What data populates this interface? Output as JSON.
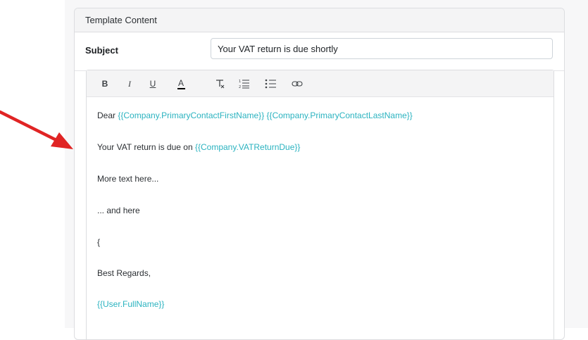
{
  "panel": {
    "title": "Template Content"
  },
  "subject": {
    "label": "Subject",
    "value": "Your VAT return is due shortly"
  },
  "toolbar": {
    "buttons": [
      {
        "name": "bold",
        "glyph": "B"
      },
      {
        "name": "italic",
        "glyph": "I"
      },
      {
        "name": "underline",
        "glyph": "U"
      },
      {
        "name": "font-color",
        "glyph": "A"
      }
    ]
  },
  "editor": {
    "greeting": "Dear ",
    "first_name_tag": "{{Company.PrimaryContactFirstName}}",
    "last_name_tag": "{{Company.PrimaryContactLastName}}",
    "vat_text": "Your VAT return is due on ",
    "vat_tag": "{{Company.VATReturnDue}}",
    "line3": "More text here...",
    "line4": "... and here",
    "line5": "{",
    "signoff": "Best Regards,",
    "user_tag": "{{User.FullName}}"
  },
  "colors": {
    "tag": "#2bb3c0",
    "arrow": "#e02424"
  }
}
